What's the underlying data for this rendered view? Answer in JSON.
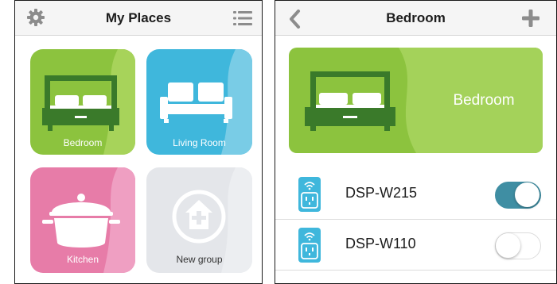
{
  "colors": {
    "bedroom_tile": "#8cc33e",
    "living_room_tile": "#3fb7dc",
    "kitchen_tile": "#e77ca8",
    "new_group_tile": "#e4e6ea",
    "toggle_on": "#3f8ea3",
    "device_icon": "#3fb7dc"
  },
  "left_screen": {
    "title": "My Places",
    "settings_icon": "gear-icon",
    "menu_icon": "list-icon",
    "tiles": [
      {
        "label": "Bedroom",
        "icon": "bed-icon"
      },
      {
        "label": "Living Room",
        "icon": "sofa-icon"
      },
      {
        "label": "Kitchen",
        "icon": "pot-icon"
      },
      {
        "label": "New group",
        "icon": "add-house-icon"
      }
    ]
  },
  "right_screen": {
    "title": "Bedroom",
    "back_icon": "chevron-left-icon",
    "add_icon": "plus-icon",
    "banner_label": "Bedroom",
    "devices": [
      {
        "name": "DSP-W215",
        "enabled": true
      },
      {
        "name": "DSP-W110",
        "enabled": false
      }
    ]
  }
}
